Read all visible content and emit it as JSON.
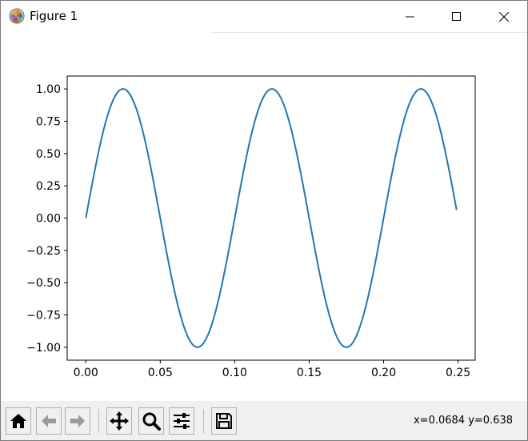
{
  "window": {
    "title": "Figure 1",
    "icons": {
      "app": "matplotlib-logo-icon",
      "minimize": "minimize-icon",
      "maximize": "maximize-icon",
      "close": "close-icon"
    }
  },
  "toolbar": {
    "buttons": [
      {
        "name": "home",
        "icon": "home-icon"
      },
      {
        "name": "back",
        "icon": "arrow-left-icon"
      },
      {
        "name": "forward",
        "icon": "arrow-right-icon"
      },
      {
        "name": "pan",
        "icon": "move-icon"
      },
      {
        "name": "zoom",
        "icon": "zoom-icon"
      },
      {
        "name": "configure-subplots",
        "icon": "sliders-icon"
      },
      {
        "name": "save",
        "icon": "save-icon"
      }
    ],
    "coords": "x=0.0684 y=0.638"
  },
  "chart_data": {
    "type": "line",
    "title": "",
    "xlabel": "",
    "ylabel": "",
    "xlim": [
      -0.0125,
      0.2615
    ],
    "ylim": [
      -1.1,
      1.1
    ],
    "xticks": [
      0.0,
      0.05,
      0.1,
      0.15,
      0.2,
      0.25
    ],
    "xtick_labels": [
      "0.00",
      "0.05",
      "0.10",
      "0.15",
      "0.20",
      "0.25"
    ],
    "yticks": [
      -1.0,
      -0.75,
      -0.5,
      -0.25,
      0.0,
      0.25,
      0.5,
      0.75,
      1.0
    ],
    "ytick_labels": [
      "−1.00",
      "−0.75",
      "−0.50",
      "−0.25",
      "0.00",
      "0.25",
      "0.50",
      "0.75",
      "1.00"
    ],
    "grid": false,
    "line_color": "#1f77b4",
    "series": [
      {
        "function": "sin(2*pi*10*t)",
        "x": [
          0.0,
          0.0125,
          0.025,
          0.0375,
          0.05,
          0.0625,
          0.075,
          0.0875,
          0.1,
          0.1125,
          0.125,
          0.1375,
          0.15,
          0.1625,
          0.175,
          0.1875,
          0.2,
          0.2125,
          0.225,
          0.2375,
          0.249
        ],
        "y": [
          0.0,
          0.707,
          1.0,
          0.707,
          0.0,
          -0.707,
          -1.0,
          -0.707,
          0.0,
          0.707,
          1.0,
          0.707,
          0.0,
          -0.707,
          -1.0,
          -0.707,
          0.0,
          0.707,
          1.0,
          0.707,
          0.063
        ]
      }
    ]
  }
}
